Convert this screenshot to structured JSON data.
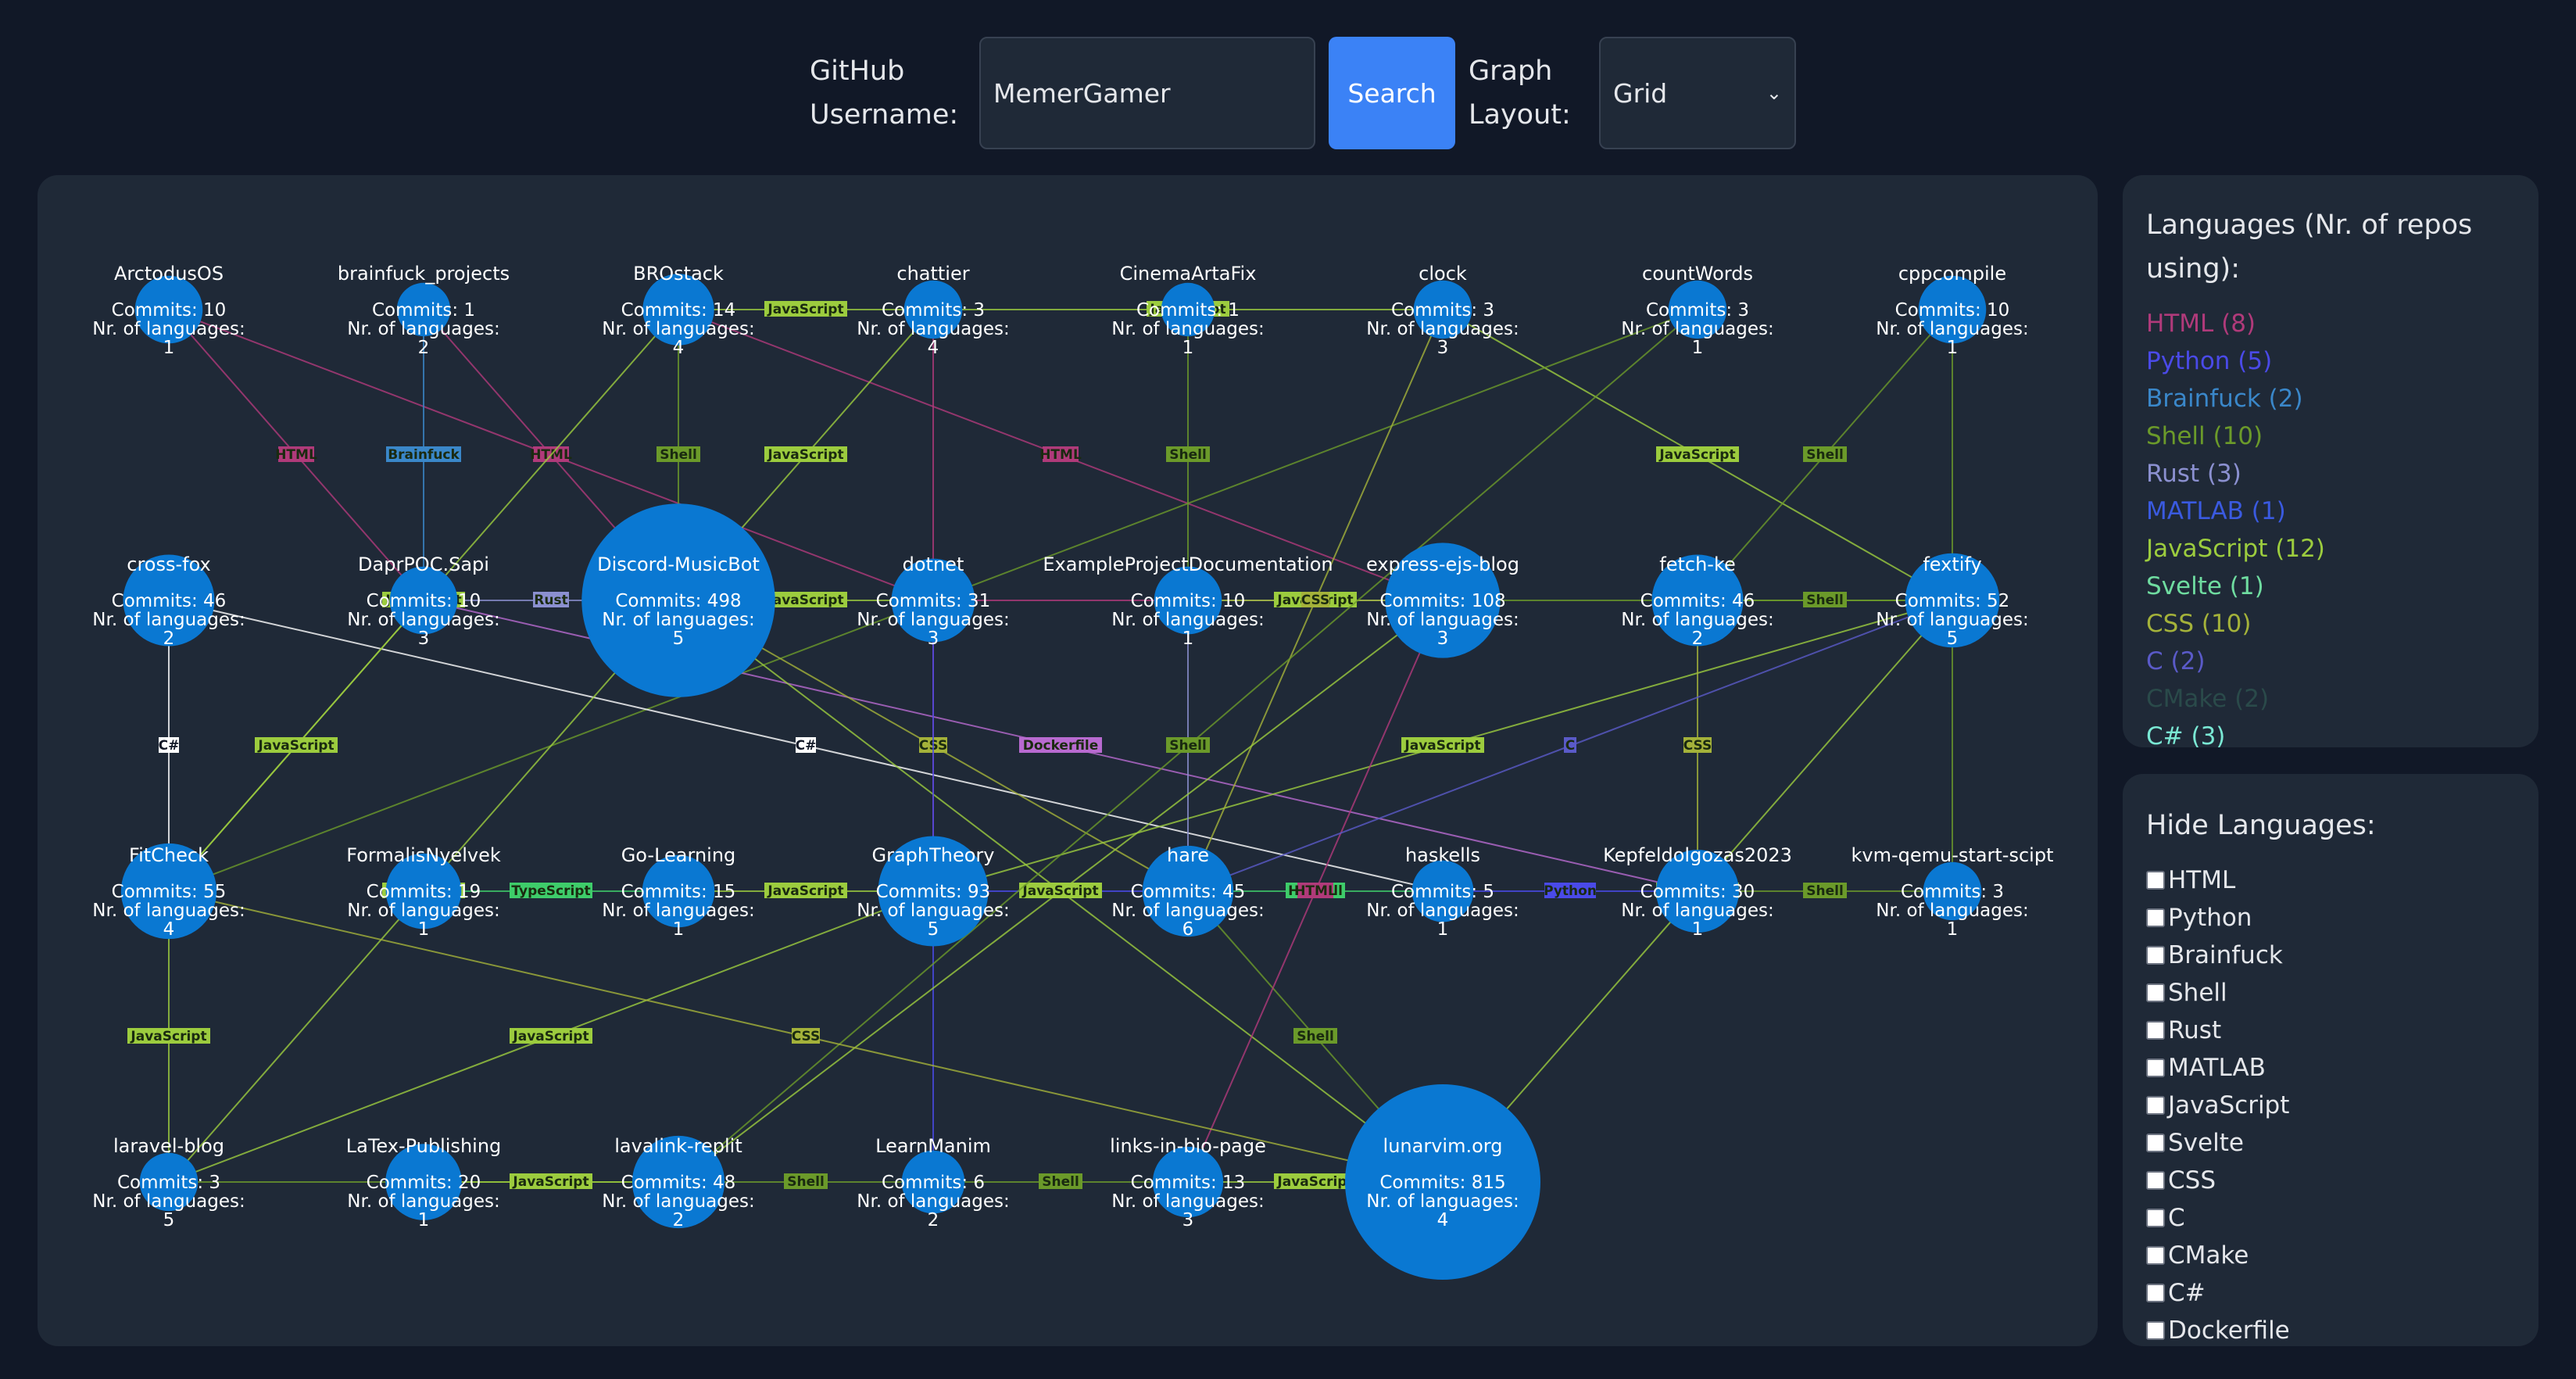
{
  "header": {
    "username_label": "GitHub Username:",
    "username_value": "MemerGamer",
    "search_label": "Search",
    "layout_label": "Graph Layout:",
    "layout_value": "Grid"
  },
  "graph": {
    "commits_prefix": "Commits: ",
    "languages_prefix": "Nr. of languages:",
    "node_color": "#0a78d2",
    "nodes": [
      {
        "name": "ArctodusOS",
        "commits": 10,
        "languages": 1
      },
      {
        "name": "brainfuck_projects",
        "commits": 1,
        "languages": 2
      },
      {
        "name": "BROstack",
        "commits": 14,
        "languages": 4
      },
      {
        "name": "chattier",
        "commits": 3,
        "languages": 4
      },
      {
        "name": "CinemaArtaFix",
        "commits": 1,
        "languages": 1
      },
      {
        "name": "clock",
        "commits": 3,
        "languages": 3
      },
      {
        "name": "countWords",
        "commits": 3,
        "languages": 1
      },
      {
        "name": "cppcompile",
        "commits": 10,
        "languages": 1
      },
      {
        "name": "cross-fox",
        "commits": 46,
        "languages": 2
      },
      {
        "name": "DaprPOC.Sapi",
        "commits": 10,
        "languages": 3
      },
      {
        "name": "Discord-MusicBot",
        "commits": 498,
        "languages": 5
      },
      {
        "name": "dotnet",
        "commits": 31,
        "languages": 3
      },
      {
        "name": "ExampleProjectDocumentation",
        "commits": 10,
        "languages": 1
      },
      {
        "name": "express-ejs-blog",
        "commits": 108,
        "languages": 3
      },
      {
        "name": "fetch-ke",
        "commits": 46,
        "languages": 2
      },
      {
        "name": "fextify",
        "commits": 52,
        "languages": 5
      },
      {
        "name": "FitCheck",
        "commits": 55,
        "languages": 4
      },
      {
        "name": "FormalisNyelvek",
        "commits": 19,
        "languages": 1
      },
      {
        "name": "Go-Learning",
        "commits": 15,
        "languages": 1
      },
      {
        "name": "GraphTheory",
        "commits": 93,
        "languages": 5
      },
      {
        "name": "hare",
        "commits": 45,
        "languages": 6
      },
      {
        "name": "haskells",
        "commits": 5,
        "languages": 1
      },
      {
        "name": "Kepfeldolgozas2023",
        "commits": 30,
        "languages": 1
      },
      {
        "name": "kvm-qemu-start-scipt",
        "commits": 3,
        "languages": 1
      },
      {
        "name": "laravel-blog",
        "commits": 3,
        "languages": 5
      },
      {
        "name": "LaTex-Publishing",
        "commits": 20,
        "languages": 1
      },
      {
        "name": "lavalink-replit",
        "commits": 48,
        "languages": 2
      },
      {
        "name": "LearnManim",
        "commits": 6,
        "languages": 2
      },
      {
        "name": "links-in-bio-page",
        "commits": 13,
        "languages": 3
      },
      {
        "name": "lunarvim.org",
        "commits": 815,
        "languages": 4
      }
    ],
    "edges": [
      {
        "a": 0,
        "b": 9,
        "lang": "HTML"
      },
      {
        "a": 0,
        "b": 11,
        "lang": "HTML"
      },
      {
        "a": 1,
        "b": 9,
        "lang": "Brainfuck"
      },
      {
        "a": 1,
        "b": 10,
        "lang": "HTML"
      },
      {
        "a": 2,
        "b": 3,
        "lang": "JavaScript"
      },
      {
        "a": 2,
        "b": 10,
        "lang": "Shell"
      },
      {
        "a": 2,
        "b": 13,
        "lang": "HTML"
      },
      {
        "a": 3,
        "b": 5,
        "lang": "JavaScript"
      },
      {
        "a": 3,
        "b": 19,
        "lang": "HTML"
      },
      {
        "a": 4,
        "b": 12,
        "lang": "Shell"
      },
      {
        "a": 5,
        "b": 15,
        "lang": "JavaScript"
      },
      {
        "a": 6,
        "b": 16,
        "lang": "Shell"
      },
      {
        "a": 7,
        "b": 14,
        "lang": "Shell"
      },
      {
        "a": 8,
        "b": 21,
        "lang": "C#"
      },
      {
        "a": 9,
        "b": 10,
        "lang": "Rust"
      },
      {
        "a": 9,
        "b": 22,
        "lang": "Dockerfile"
      },
      {
        "a": 10,
        "b": 11,
        "lang": "JavaScript"
      },
      {
        "a": 10,
        "b": 20,
        "lang": "CSS"
      },
      {
        "a": 11,
        "b": 13,
        "lang": "HTML"
      },
      {
        "a": 12,
        "b": 13,
        "lang": "JavaScript"
      },
      {
        "a": 13,
        "b": 15,
        "lang": "Shell"
      },
      {
        "a": 14,
        "b": 15,
        "lang": "Shell"
      },
      {
        "a": 15,
        "b": 19,
        "lang": "JavaScript"
      },
      {
        "a": 16,
        "b": 24,
        "lang": "JavaScript"
      },
      {
        "a": 16,
        "b": 8,
        "lang": "C#"
      },
      {
        "a": 17,
        "b": 18,
        "lang": "TypeScript"
      },
      {
        "a": 18,
        "b": 19,
        "lang": "JavaScript"
      },
      {
        "a": 19,
        "b": 20,
        "lang": "Python"
      },
      {
        "a": 20,
        "b": 21,
        "lang": "Haskell"
      },
      {
        "a": 20,
        "b": 29,
        "lang": "Shell"
      },
      {
        "a": 21,
        "b": 22,
        "lang": "Python"
      },
      {
        "a": 22,
        "b": 23,
        "lang": "Shell"
      },
      {
        "a": 24,
        "b": 26,
        "lang": "Shell"
      },
      {
        "a": 24,
        "b": 19,
        "lang": "JavaScript"
      },
      {
        "a": 25,
        "b": 26,
        "lang": "JavaScript"
      },
      {
        "a": 26,
        "b": 27,
        "lang": "Shell"
      },
      {
        "a": 27,
        "b": 28,
        "lang": "Shell"
      },
      {
        "a": 28,
        "b": 29,
        "lang": "JavaScript"
      },
      {
        "a": 29,
        "b": 10,
        "lang": "JavaScript"
      },
      {
        "a": 29,
        "b": 15,
        "lang": "JavaScript"
      },
      {
        "a": 3,
        "b": 10,
        "lang": "JavaScript"
      },
      {
        "a": 10,
        "b": 24,
        "lang": "JavaScript"
      },
      {
        "a": 11,
        "b": 27,
        "lang": "Python"
      },
      {
        "a": 13,
        "b": 28,
        "lang": "HTML"
      },
      {
        "a": 2,
        "b": 16,
        "lang": "JavaScript"
      },
      {
        "a": 5,
        "b": 20,
        "lang": "CSS"
      },
      {
        "a": 12,
        "b": 20,
        "lang": "Rust"
      },
      {
        "a": 13,
        "b": 26,
        "lang": "JavaScript"
      },
      {
        "a": 6,
        "b": 26,
        "lang": "Shell"
      },
      {
        "a": 7,
        "b": 23,
        "lang": "Shell"
      },
      {
        "a": 16,
        "b": 29,
        "lang": "CSS"
      },
      {
        "a": 9,
        "b": 16,
        "lang": "JavaScript"
      },
      {
        "a": 14,
        "b": 22,
        "lang": "CSS"
      },
      {
        "a": 20,
        "b": 15,
        "lang": "C"
      }
    ]
  },
  "legend": {
    "title": "Languages (Nr. of repos using):",
    "items": [
      {
        "label": "HTML (8)",
        "color": "#b03a7a"
      },
      {
        "label": "Python (5)",
        "color": "#4a4ae8"
      },
      {
        "label": "Brainfuck (2)",
        "color": "#3a87c9"
      },
      {
        "label": "Shell (10)",
        "color": "#6b9a2a"
      },
      {
        "label": "Rust (3)",
        "color": "#8b90d0"
      },
      {
        "label": "MATLAB (1)",
        "color": "#3a5ae0"
      },
      {
        "label": "JavaScript (12)",
        "color": "#9ccc3e"
      },
      {
        "label": "Svelte (1)",
        "color": "#6fdca0"
      },
      {
        "label": "CSS (10)",
        "color": "#a4b23a"
      },
      {
        "label": "C (2)",
        "color": "#5a5ac8"
      },
      {
        "label": "CMake (2)",
        "color": "#2a4a4a"
      },
      {
        "label": "C# (3)",
        "color": "#7ae8d4"
      }
    ]
  },
  "hide": {
    "title": "Hide Languages:",
    "options": [
      "HTML",
      "Python",
      "Brainfuck",
      "Shell",
      "Rust",
      "MATLAB",
      "JavaScript",
      "Svelte",
      "CSS",
      "C",
      "CMake",
      "C#",
      "Dockerfile"
    ]
  },
  "lang_colors": {
    "HTML": "#b03a7a",
    "Python": "#4a4ae8",
    "Brainfuck": "#3a87c9",
    "Shell": "#6b9a2a",
    "Rust": "#8b90d0",
    "MATLAB": "#3a5ae0",
    "JavaScript": "#9ccc3e",
    "Svelte": "#6fdca0",
    "CSS": "#a4b23a",
    "C": "#5a5ac8",
    "CMake": "#2a4a4a",
    "C#": "#ffffff",
    "Dockerfile": "#b86ad0",
    "TypeScript": "#3ecc6a",
    "Haskell": "#3ecc6a"
  }
}
